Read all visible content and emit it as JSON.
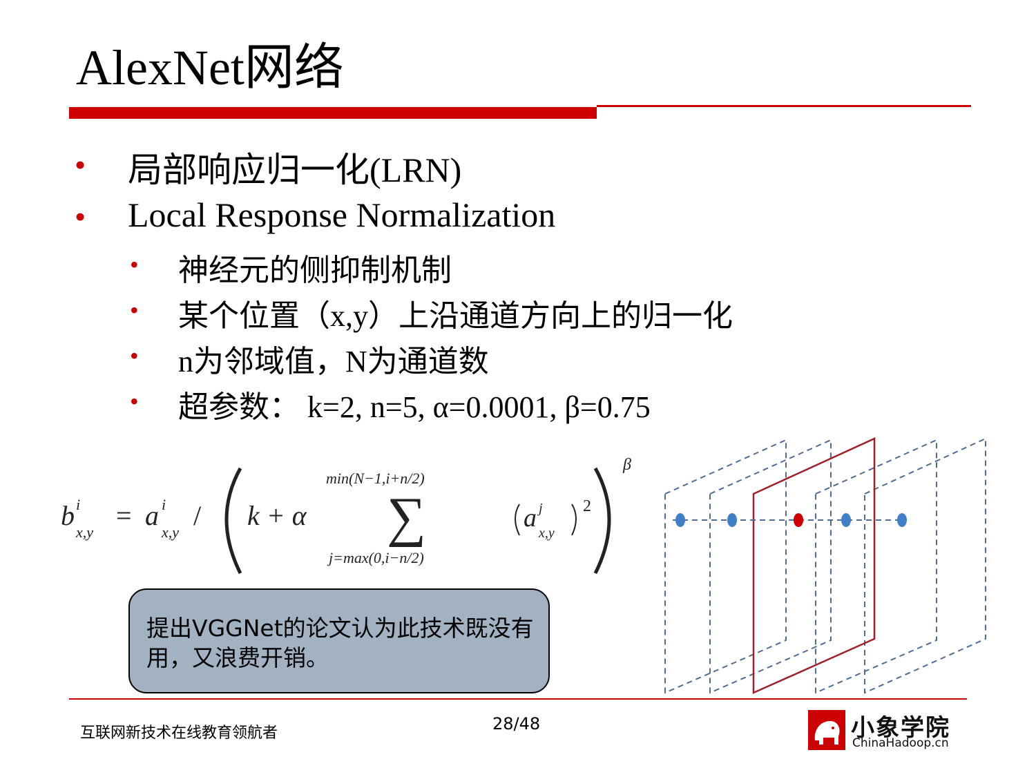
{
  "title": "AlexNet网络",
  "bullets": [
    {
      "text": "局部响应归一化(LRN)"
    },
    {
      "text": "Local Response Normalization"
    }
  ],
  "sub_bullets": [
    {
      "text": "神经元的侧抑制机制"
    },
    {
      "text": "某个位置（x,y）上沿通道方向上的归一化"
    },
    {
      "text": "n为邻域值，N为通道数"
    },
    {
      "text": "超参数：  k=2, n=5, α=0.0001, β=0.75"
    }
  ],
  "bullet_symbol": "•",
  "formula": {
    "lhs_base": "b",
    "sup_i": "i",
    "sub_xy": "x,y",
    "equals": "=",
    "a_base": "a",
    "slash": "/",
    "k_plus_alpha": "k + α",
    "sum_upper": "min(N−1,i+n/2)",
    "sum_symbol": "∑",
    "sum_lower": "j=max(0,i−n/2)",
    "sup_j": "j",
    "square": "2",
    "beta": "β"
  },
  "callout": {
    "text": "提出VGGNet的论文认为此技术既没有用，又浪费开销。"
  },
  "footer": {
    "left_text": "互联网新技术在线教育领航者",
    "page_number": "28/48",
    "logo_cn": "小象学院",
    "logo_en": "ChinaHadoop.cn"
  },
  "colors": {
    "accent": "#cc0000",
    "callout_fill": "#a3b2c3",
    "dashed_plane": "#4f6b8f",
    "highlight_plane": "#a01e2a",
    "neuron_blue": "#3f7fc8",
    "neuron_red": "#cc0000"
  }
}
